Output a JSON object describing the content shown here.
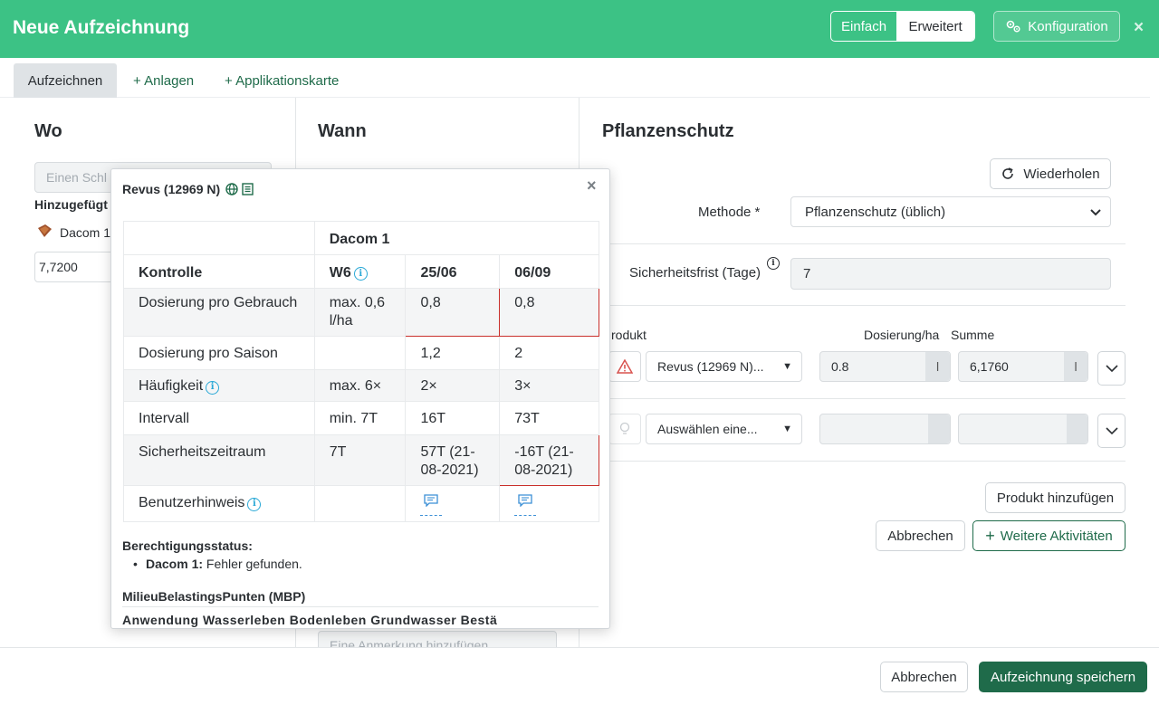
{
  "header": {
    "title": "Neue Aufzeichnung",
    "mode_simple": "Einfach",
    "mode_advanced": "Erweitert",
    "config_label": "Konfiguration",
    "close": "×"
  },
  "tabs": [
    {
      "label": "Aufzeichnen"
    },
    {
      "label": "+ Anlagen"
    },
    {
      "label": "+ Applikationskarte"
    }
  ],
  "wo": {
    "title": "Wo",
    "search_placeholder": "Einen Schl",
    "added_label": "Hinzugefügt",
    "field_name": "Dacom 1",
    "area_value": "7,7200"
  },
  "wann": {
    "title": "Wann",
    "note_placeholder": "Eine Anmerkung hinzufügen"
  },
  "pflanzenschutz": {
    "title": "Pflanzenschutz",
    "repeat_button": "Wiederholen",
    "method_label": "Methode *",
    "method_value": "Pflanzenschutz (üblich)",
    "safety_label": "Sicherheitsfrist (Tage)",
    "safety_value": "7",
    "product_label": "rodukt",
    "dose_label": "Dosierung/ha",
    "sum_label": "Summe",
    "product_1": "Revus (12969 N)...",
    "dose_1": "0.8",
    "unit_1": "l",
    "sum_1": "6,1760",
    "sum_unit_1": "l",
    "product_2": "Auswählen eine...",
    "add_product": "Produkt hinzufügen",
    "cancel": "Abbrechen",
    "more_activities": "Weitere Aktivitäten"
  },
  "footer": {
    "cancel": "Abbrechen",
    "save": "Aufzeichnung speichern"
  },
  "popup": {
    "title": "Revus (12969 N)",
    "field": "Dacom 1",
    "columns": [
      "Kontrolle",
      "W6",
      "25/06",
      "06/09"
    ],
    "rows": [
      {
        "label": "Dosierung pro Gebrauch",
        "limit": "max. 0,6 l/ha",
        "c1": "0,8",
        "c2": "0,8"
      },
      {
        "label": "Dosierung pro Saison",
        "limit": "",
        "c1": "1,2",
        "c2": "2"
      },
      {
        "label": "Häufigkeit",
        "limit": "max. 6×",
        "c1": "2×",
        "c2": "3×"
      },
      {
        "label": "Intervall",
        "limit": "min. 7T",
        "c1": "16T",
        "c2": "73T"
      },
      {
        "label": "Sicherheitszeitraum",
        "limit": "7T",
        "c1": "57T (21-08-2021)",
        "c2": "-16T (21-08-2021)"
      },
      {
        "label": "Benutzerhinweis",
        "limit": "",
        "c1": "",
        "c2": ""
      }
    ],
    "status_head": "Berechtigungsstatus:",
    "status_field": "Dacom 1:",
    "status_text": "Fehler gefunden.",
    "mbp_head": "MilieuBelastingsPunten (MBP)",
    "mbp_cut": "Anwendung    Wasserleben    Bodenleben    Grundwasser    Bestä"
  }
}
